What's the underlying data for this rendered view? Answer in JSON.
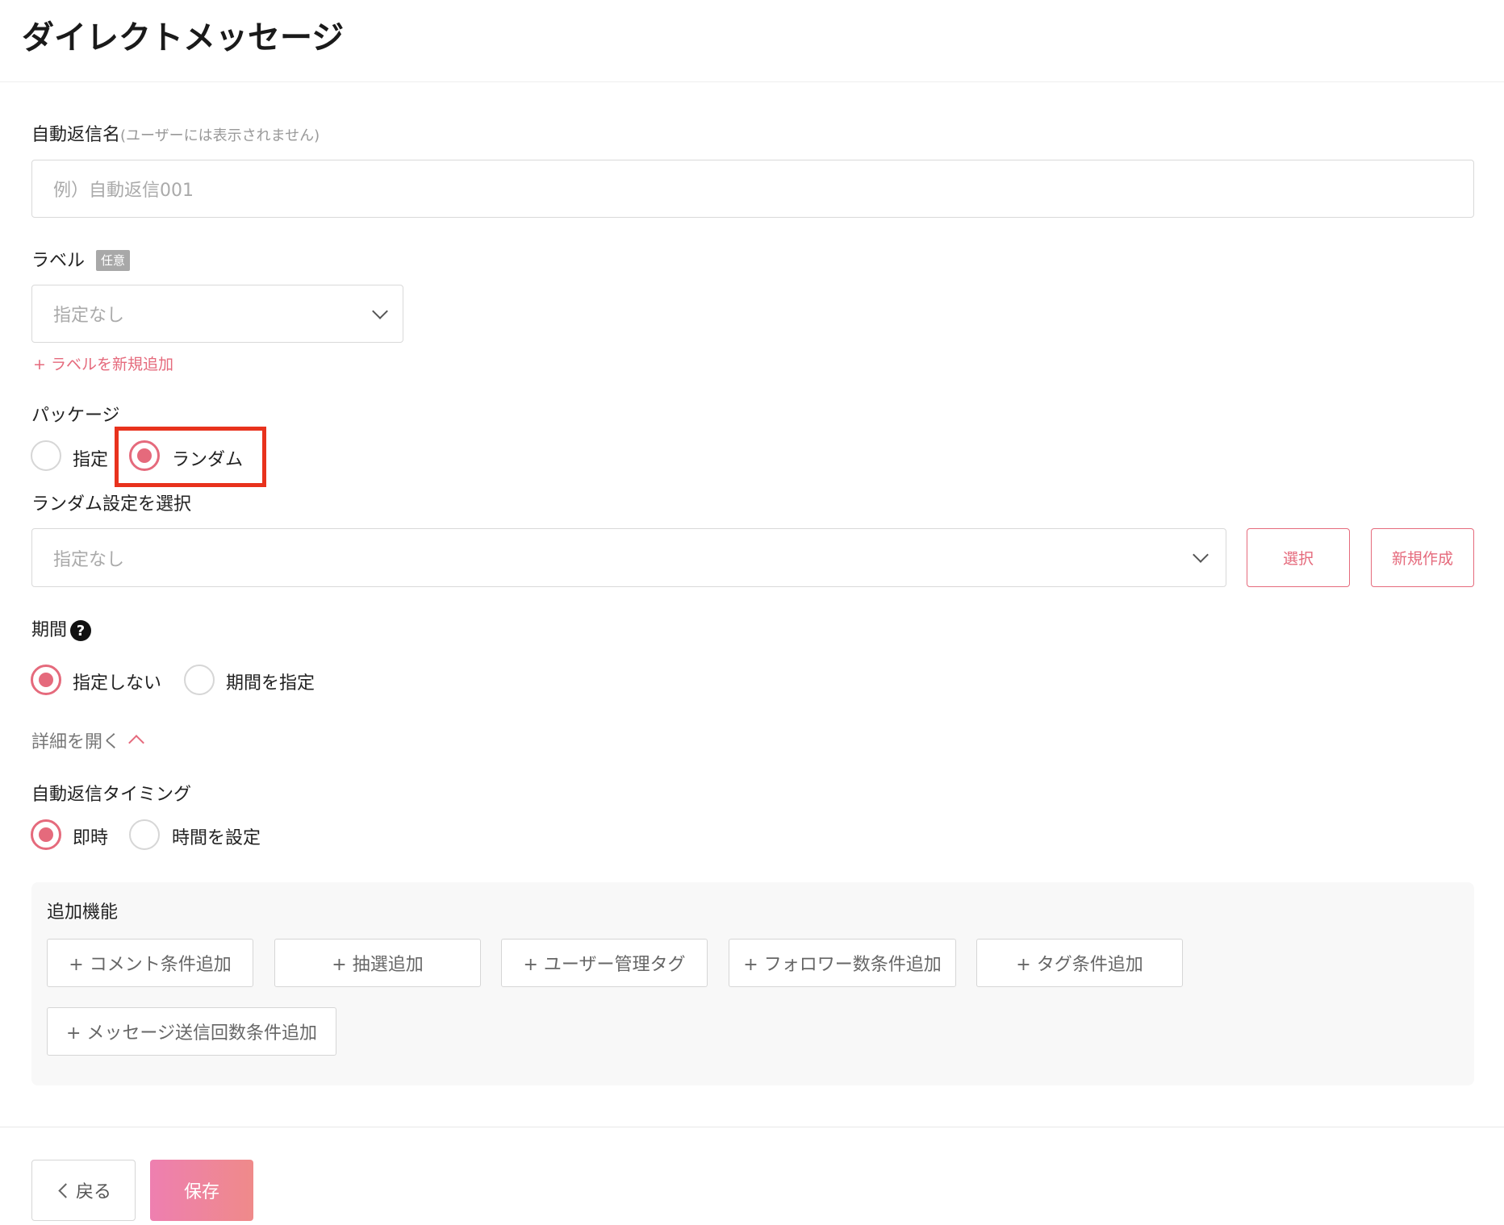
{
  "header": {
    "title": "ダイレクトメッセージ"
  },
  "auto_reply_name": {
    "label": "自動返信名",
    "hint": "(ユーザーには表示されません)",
    "placeholder": "例）自動返信001"
  },
  "label_field": {
    "label": "ラベル",
    "badge": "任意",
    "selected": "指定なし",
    "add_link": "+ ラベルを新規追加"
  },
  "package": {
    "label": "パッケージ",
    "options": [
      {
        "label": "指定",
        "selected": false
      },
      {
        "label": "ランダム",
        "selected": true
      }
    ]
  },
  "random_setting": {
    "label": "ランダム設定を選択",
    "selected": "指定なし",
    "select_button": "選択",
    "new_button": "新規作成"
  },
  "period": {
    "label": "期間",
    "help_icon": "?",
    "options": [
      {
        "label": "指定しない",
        "selected": true
      },
      {
        "label": "期間を指定",
        "selected": false
      }
    ]
  },
  "details_link": "詳細を開く",
  "timing": {
    "label": "自動返信タイミング",
    "options": [
      {
        "label": "即時",
        "selected": true
      },
      {
        "label": "時間を設定",
        "selected": false
      }
    ]
  },
  "extra": {
    "label": "追加機能",
    "buttons": [
      "+ コメント条件追加",
      "+ 抽選追加",
      "+ ユーザー管理タグ",
      "+ フォロワー数条件追加",
      "+ タグ条件追加",
      "+ メッセージ送信回数条件追加"
    ]
  },
  "footer": {
    "back": "戻る",
    "save": "保存"
  },
  "colors": {
    "accent": "#e56a7c",
    "highlight": "#e8321d"
  }
}
